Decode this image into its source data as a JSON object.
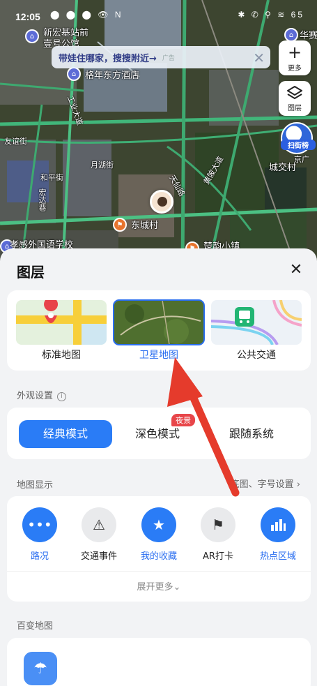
{
  "status": {
    "time": "12:05",
    "left_icons": "⬤ ⬤ ⬤ 👁 N",
    "right_icons": "✱ ✆ ⚲ ≋ 65"
  },
  "map": {
    "labels": [
      "新宏基站前",
      "壹号公馆",
      "格年东方酒店",
      "华赛",
      "友谊街",
      "和平街",
      "月湖街",
      "宏达巷",
      "东城村",
      "孝感外国语学校",
      "楚韵小镇",
      "城交村",
      "京广",
      "工业大道",
      "黄陂大道",
      "天仙路"
    ],
    "banner": {
      "text": "带娃住哪家，搜搜附近→",
      "ad": "广告"
    },
    "more_label": "更多",
    "layers_label": "图层",
    "rank_label": "扫街榜"
  },
  "panel": {
    "title": "图层",
    "map_types": [
      {
        "label": "标准地图",
        "icon": "standard-map-thumb"
      },
      {
        "label": "卫星地图",
        "icon": "satellite-map-thumb"
      },
      {
        "label": "公共交通",
        "icon": "transit-map-thumb"
      }
    ],
    "appearance_label": "外观设置",
    "modes": [
      "经典模式",
      "深色模式",
      "跟随系统"
    ],
    "night_badge": "夜景",
    "display_label": "地图显示",
    "display_link": "底图、字号设置",
    "display_items": [
      {
        "label": "路况",
        "icon": "traffic-dots-icon",
        "active": true
      },
      {
        "label": "交通事件",
        "icon": "traffic-event-icon",
        "active": false
      },
      {
        "label": "我的收藏",
        "icon": "star-icon",
        "active": true
      },
      {
        "label": "AR打卡",
        "icon": "flag-icon",
        "active": false
      },
      {
        "label": "热点区域",
        "icon": "heat-bar-icon",
        "active": true
      }
    ],
    "expand_label": "展开更多",
    "variety_label": "百变地图"
  }
}
